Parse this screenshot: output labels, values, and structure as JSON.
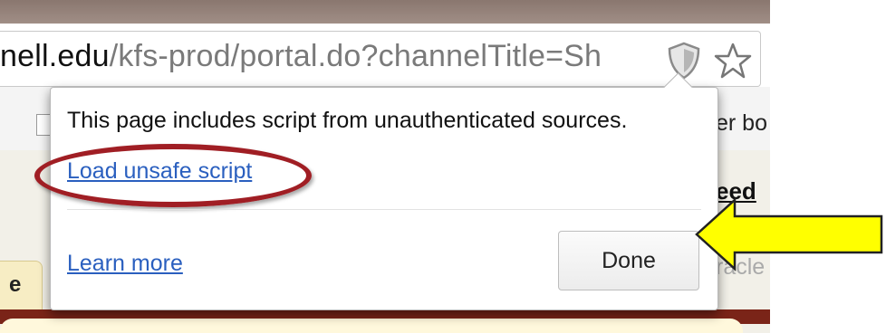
{
  "browser": {
    "url_host_part": "nell.edu",
    "url_path_part": "/kfs-prod/portal.do?channelTitle=Sh",
    "security_icon": "shield-icon",
    "bookmark_icon": "star-icon"
  },
  "background": {
    "bookmarks_partial": "er bo",
    "feed_partial": "eed",
    "tab_partial": "e",
    "faded_partial": "racle"
  },
  "popup": {
    "message": "This page includes script from unauthenticated sources.",
    "load_link": "Load unsafe script",
    "learn_link": "Learn more",
    "done_label": "Done"
  },
  "annotations": {
    "highlight_color": "#a01e24",
    "arrow_color": "#ffff00",
    "arrow_outline": "#222222"
  }
}
